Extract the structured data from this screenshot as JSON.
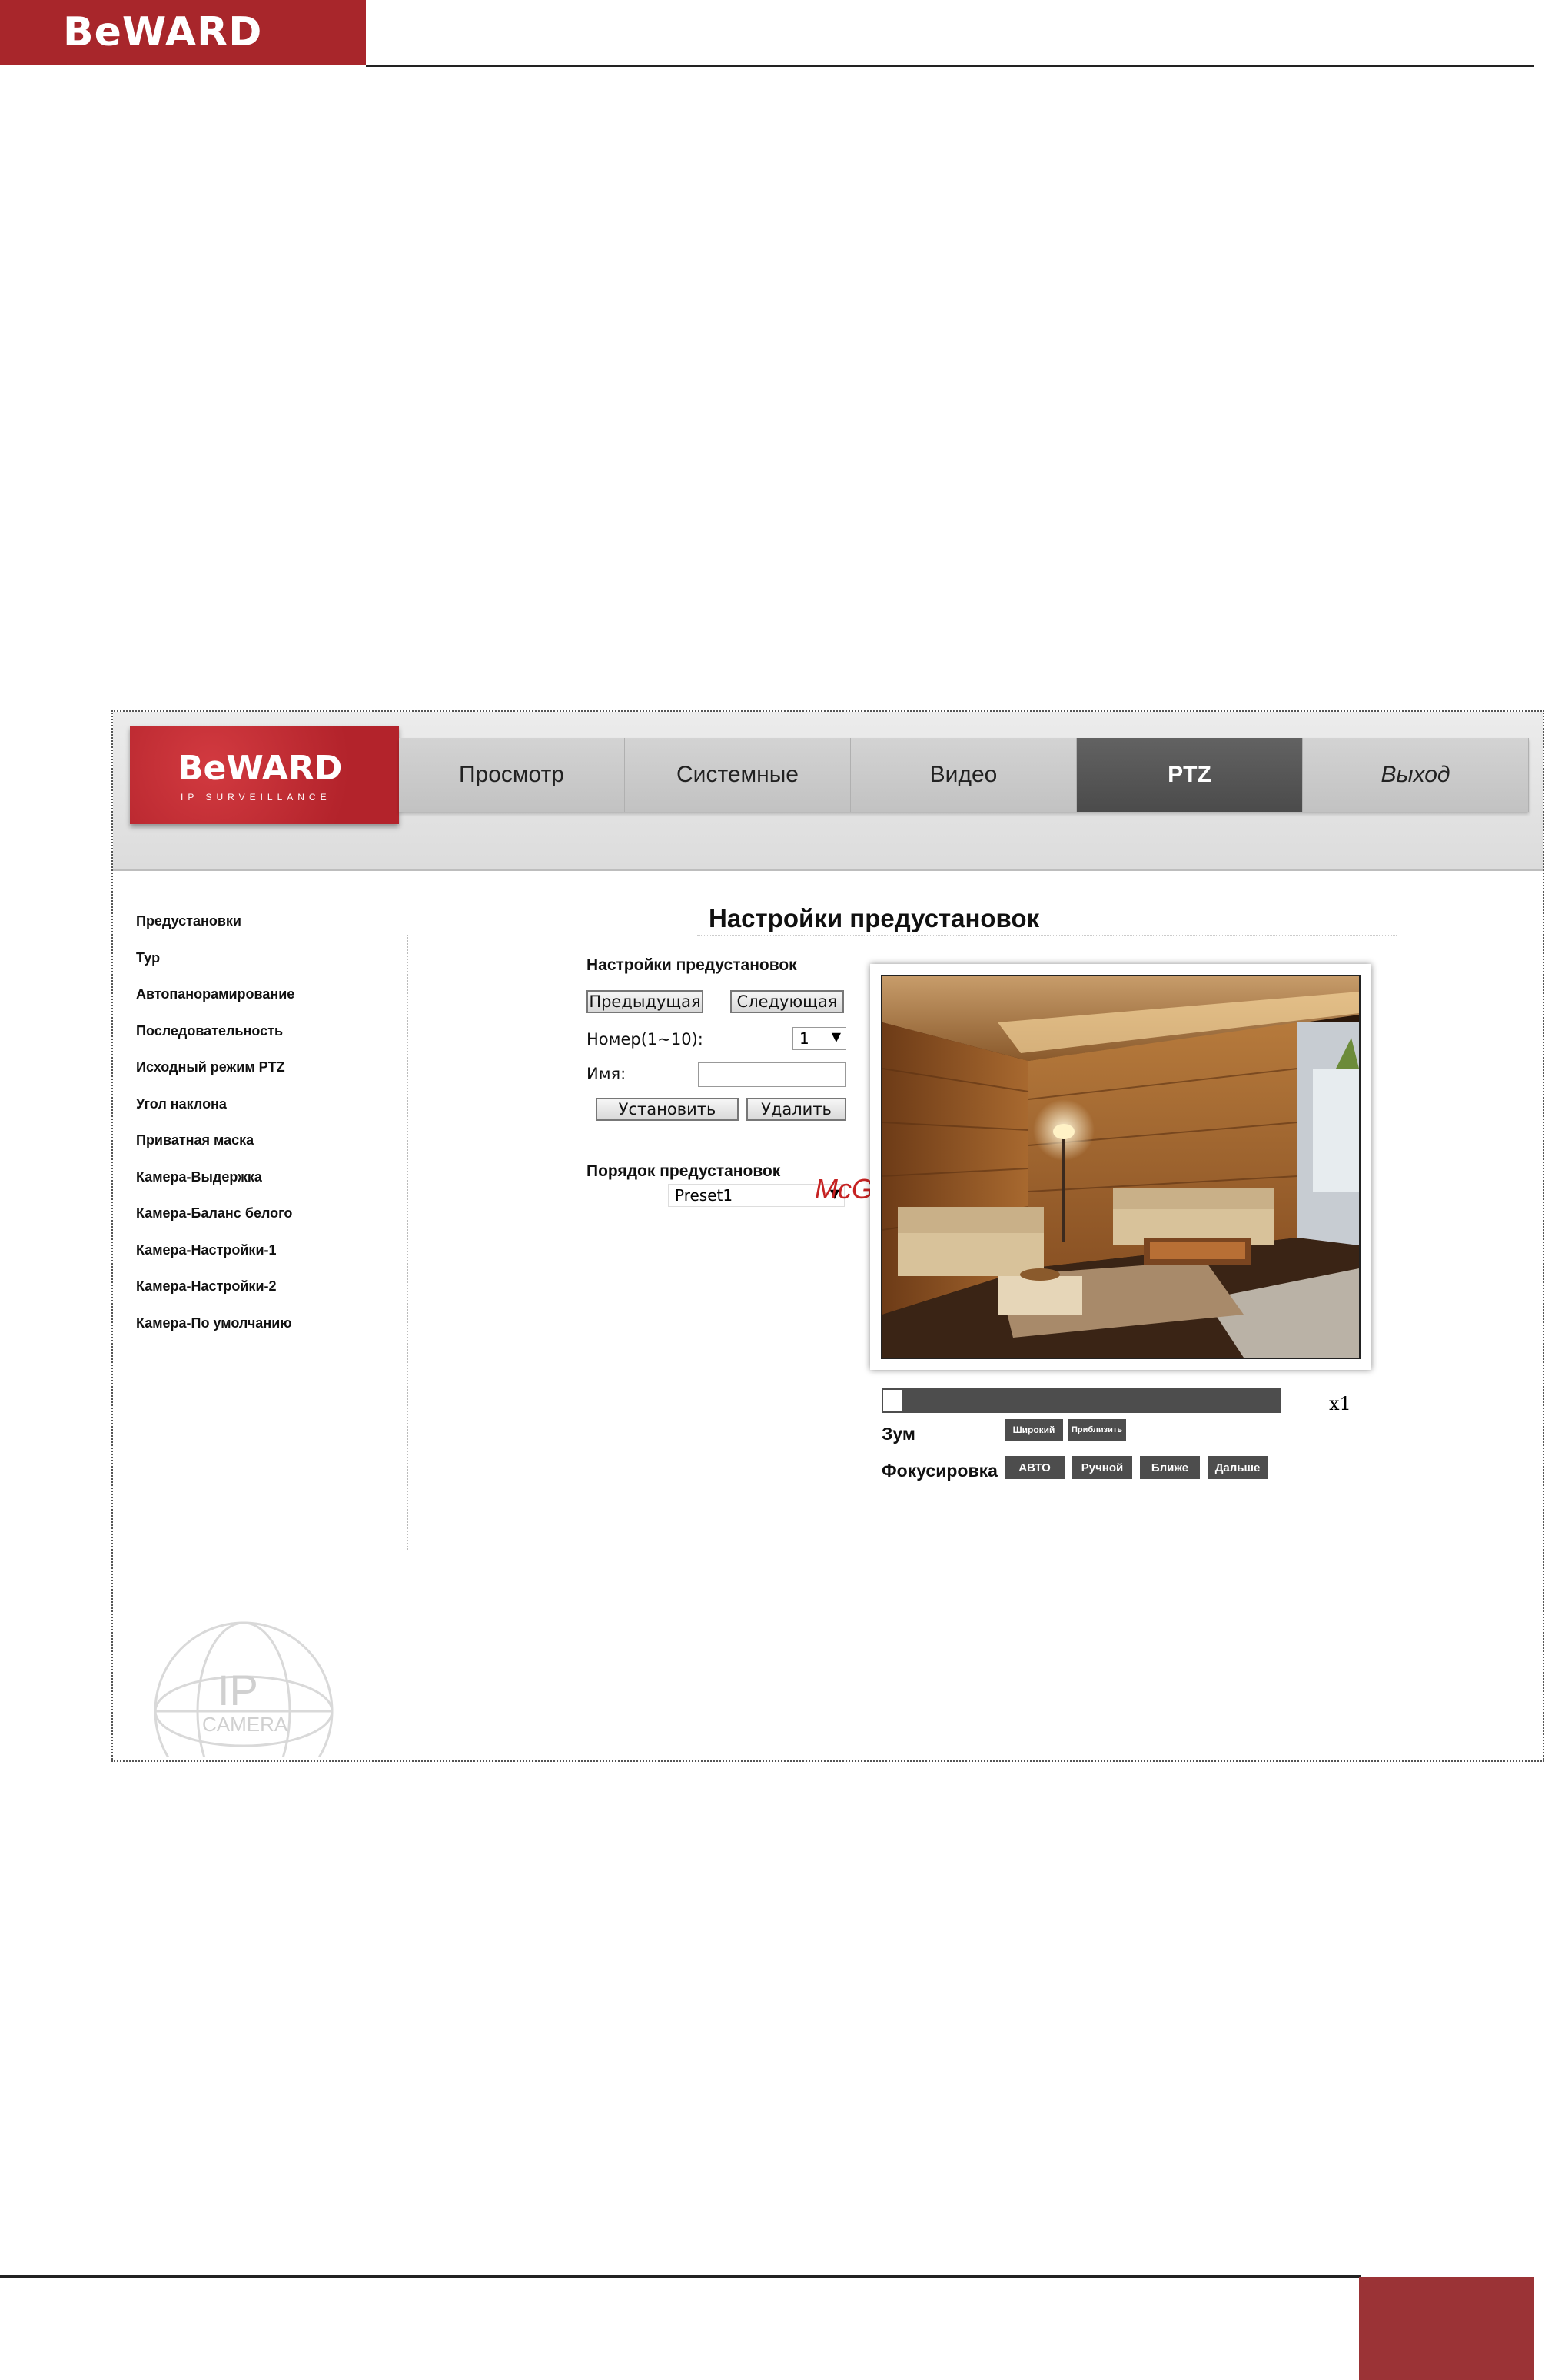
{
  "page": {
    "logo": "BeWARD"
  },
  "camera_ui": {
    "logo": {
      "brand": "BeWARD",
      "sub": "IP SURVEILLANCE"
    },
    "tabs": [
      {
        "label": "Просмотр",
        "active": false
      },
      {
        "label": "Системные",
        "active": false
      },
      {
        "label": "Видео",
        "active": false
      },
      {
        "label": "PTZ",
        "active": true
      },
      {
        "label": "Выход",
        "active": false
      }
    ],
    "sidebar": [
      "Предустановки",
      "Тур",
      "Автопанорамирование",
      "Последовательность",
      "Исходный режим PTZ",
      "Угол наклона",
      "Приватная маска",
      "Камера-Выдержка",
      "Камера-Баланс белого",
      "Камера-Настройки-1",
      "Камера-Настройки-2",
      "Камера-По умолчанию"
    ],
    "title": "Настройки предустановок",
    "preset_settings": {
      "section_title": "Настройки предустановок",
      "prev_button": "Предыдущая",
      "next_button": "Следующая",
      "number_label": "Номер(1~10):",
      "number_value": "1",
      "name_label": "Имя:",
      "name_value": "",
      "set_button": "Установить",
      "delete_button": "Удалить"
    },
    "preset_order": {
      "section_title": "Порядок предустановок",
      "select_value": "Preset1"
    },
    "overlay_watermark": "McGrp.Ru",
    "zoom": {
      "level_text": "x1",
      "slider_fraction": 0,
      "label": "Зум",
      "wide_button": "Широкий",
      "tele_button": "Приблизить"
    },
    "focus": {
      "label": "Фокусировка",
      "auto_button": "АВТО",
      "manual_button": "Ручной",
      "near_button": "Ближе",
      "far_button": "Дальше"
    },
    "ip_watermark": {
      "big": "IP",
      "small": "CAMERA"
    }
  },
  "colors": {
    "brand_red": "#a8262b",
    "footer_red": "#9b3336",
    "active_tab": "#555555",
    "control_button": "#4d4d4d"
  }
}
